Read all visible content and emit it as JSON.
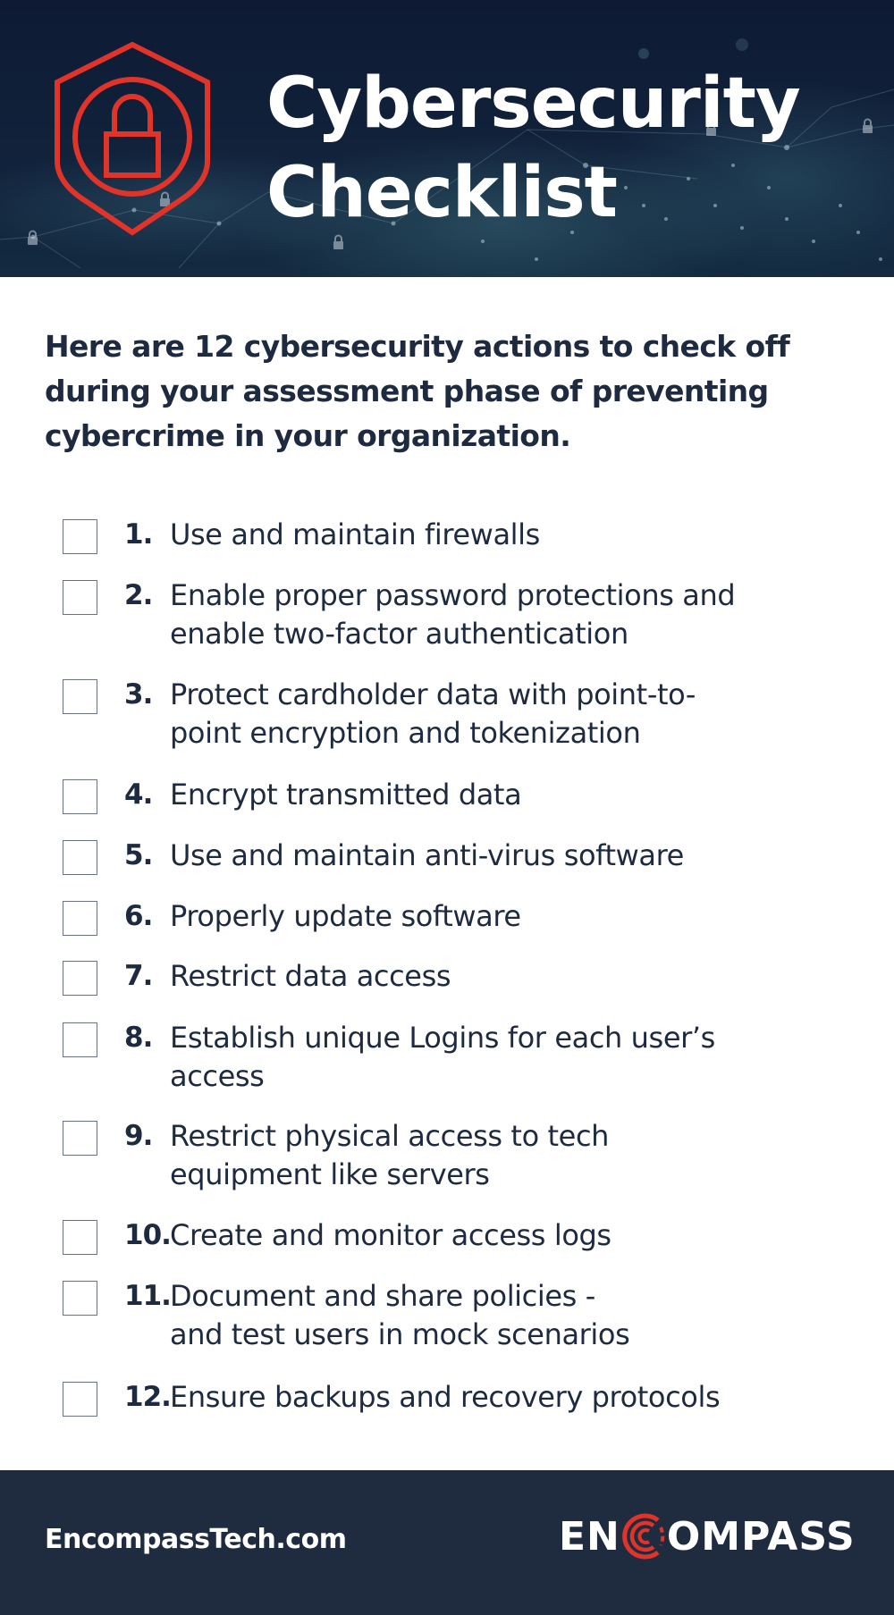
{
  "header": {
    "icon": "shield-lock-icon",
    "title_line1": "Cybersecurity",
    "title_line2": "Checklist",
    "accent_color": "#e0342a",
    "background_color": "#0e1a33"
  },
  "intro": {
    "text": "Here are 12 cybersecurity actions to check off during your assessment phase of preventing cybercrime in your organization."
  },
  "checklist": {
    "items": [
      {
        "number": "1.",
        "text": "Use and maintain firewalls",
        "checked": false
      },
      {
        "number": "2.",
        "text": "Enable proper password protections and\nenable two-factor authentication",
        "checked": false
      },
      {
        "number": "3.",
        "text": "Protect cardholder data with point-to-\npoint encryption and tokenization",
        "checked": false
      },
      {
        "number": "4.",
        "text": "Encrypt transmitted data",
        "checked": false
      },
      {
        "number": "5.",
        "text": "Use and maintain anti-virus software",
        "checked": false
      },
      {
        "number": "6.",
        "text": "Properly update software",
        "checked": false
      },
      {
        "number": "7.",
        "text": "Restrict data access",
        "checked": false
      },
      {
        "number": "8.",
        "text": "Establish unique Logins for each user’s\naccess",
        "checked": false
      },
      {
        "number": "9.",
        "text": "Restrict physical access to tech\nequipment like servers",
        "checked": false
      },
      {
        "number": "10.",
        "text": "Create and monitor access logs",
        "checked": false
      },
      {
        "number": "11.",
        "text": "Document and share policies -\nand test users in mock scenarios",
        "checked": false
      },
      {
        "number": "12.",
        "text": "Ensure backups and recovery protocols",
        "checked": false
      }
    ]
  },
  "footer": {
    "website": "EncompassTech.com",
    "logo_prefix": "EN",
    "logo_icon": "concentric-c-icon",
    "logo_suffix": "OMPASS",
    "background_color": "#1f2b3e"
  }
}
